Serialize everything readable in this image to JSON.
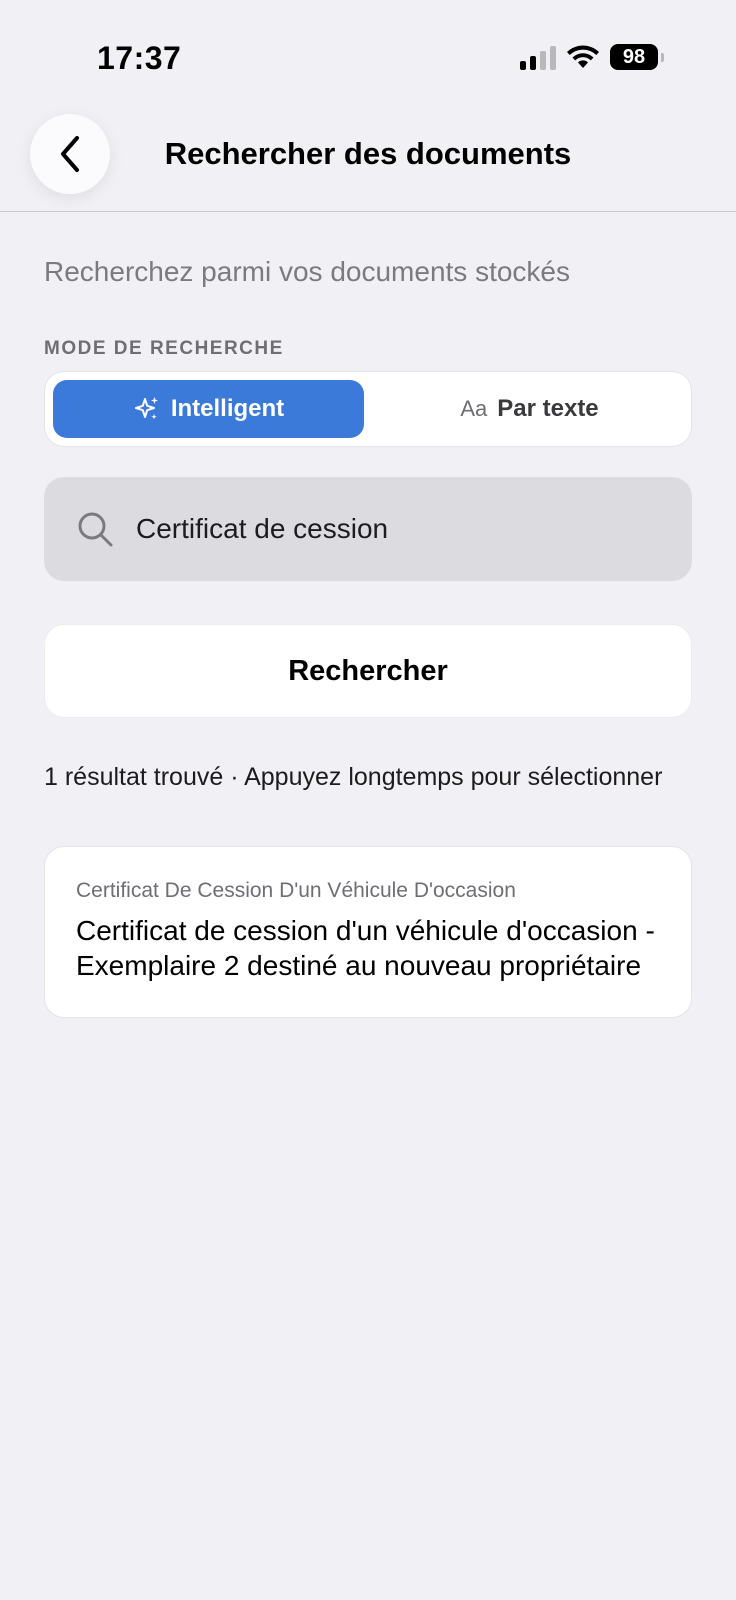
{
  "status_bar": {
    "time": "17:37",
    "battery": "98",
    "icons": [
      "signal-icon",
      "wifi-icon",
      "battery-icon"
    ]
  },
  "nav": {
    "title": "Rechercher des documents",
    "back_icon": "chevron-left-icon"
  },
  "subtitle": "Recherchez parmi vos documents stockés",
  "search_mode": {
    "label": "MODE DE RECHERCHE",
    "options": [
      {
        "label": "Intelligent",
        "icon": "sparkles-icon",
        "selected": true
      },
      {
        "label": "Par texte",
        "icon": "Aa",
        "selected": false
      }
    ]
  },
  "search": {
    "value": "Certificat de cession",
    "icon": "search-icon",
    "button_label": "Rechercher"
  },
  "results": {
    "summary": "1 résultat trouvé  ·  Appuyez longtemps pour sélectionner",
    "items": [
      {
        "category": "Certificat De Cession D'un Véhicule D'occasion",
        "title": "Certificat de cession d'un véhicule d'occasion - Exemplaire 2 destiné au nouveau propriétaire"
      }
    ]
  },
  "colors": {
    "background": "#f1f1f5",
    "accent": "#3b7ad9",
    "field_bg": "#dcdce0"
  }
}
